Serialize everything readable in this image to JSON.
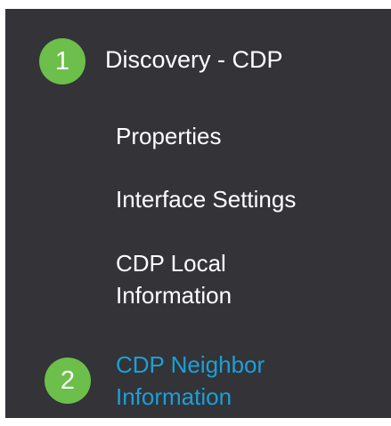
{
  "section": {
    "step": "1",
    "title": "Discovery - CDP"
  },
  "nav": {
    "items": [
      {
        "label": "Properties"
      },
      {
        "label": "Interface Settings"
      },
      {
        "label_lines": [
          "CDP Local",
          "Information"
        ]
      },
      {
        "label_lines": [
          "CDP Neighbor",
          "Information"
        ],
        "active": true,
        "step": "2"
      }
    ]
  },
  "colors": {
    "panel_bg": "#333338",
    "badge": "#6cbf4a",
    "active_link": "#1ba0d7",
    "text": "#ffffff"
  }
}
